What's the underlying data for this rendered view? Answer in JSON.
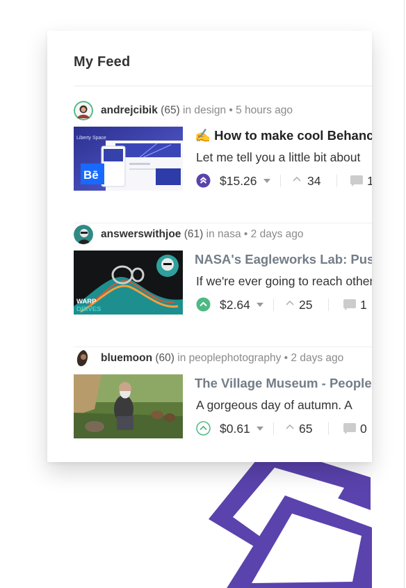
{
  "feed": {
    "title": "My Feed",
    "posts": [
      {
        "author": "andrejcibik",
        "reputation": "(65)",
        "context": " in design • 5 hours ago",
        "title": "✍️ How to make cool Behance",
        "excerpt": "Let me tell you a little bit about",
        "payout": "$15.26",
        "votes": "34",
        "comments": "1",
        "thumb": {
          "line1": "Liberty Space",
          "badge": "Bē"
        }
      },
      {
        "author": "answerswithjoe",
        "reputation": "(61)",
        "context": " in nasa • 2 days ago",
        "title": "NASA's Eagleworks Lab: Pushing",
        "excerpt": "If we're ever going to reach other",
        "payout": "$2.64",
        "votes": "25",
        "comments": "1",
        "thumb": {
          "line1": "WARP",
          "line2": "DRIVES"
        }
      },
      {
        "author": "bluemoon",
        "reputation": "(60)",
        "context": " in peoplephotography • 2 days ago",
        "title": "The Village Museum - People",
        "excerpt": "A gorgeous day of autumn. A",
        "payout": "$0.61",
        "votes": "65",
        "comments": "0"
      }
    ]
  },
  "colors": {
    "brand_purple": "#5a43ad",
    "upvote_green": "#4eb983"
  },
  "icons": [
    "upvote-icon",
    "caret-down-icon",
    "votes-icon",
    "comment-icon"
  ]
}
